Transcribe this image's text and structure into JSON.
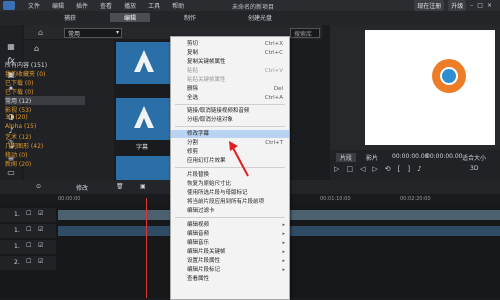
{
  "titlebar": {
    "menu": [
      "文件",
      "编辑",
      "插件",
      "查看",
      "播放",
      "工具",
      "帮助"
    ],
    "app_name": "未命名的新项目",
    "btn_register": "现在注册",
    "btn_upgrade": "升级"
  },
  "tabs": [
    {
      "label": "捕获"
    },
    {
      "label": "编辑"
    },
    {
      "label": "制作"
    },
    {
      "label": "创建光盘"
    }
  ],
  "library": {
    "dropdown": "常用",
    "search_placeholder": "搜索库",
    "categories": [
      {
        "label": "所有内容 (151)",
        "white": true
      },
      {
        "label": "我的收藏夹 (0)"
      },
      {
        "label": "已下载 (0)"
      },
      {
        "label": "已下载 (0)"
      },
      {
        "label": "常用 (12)",
        "white": true
      },
      {
        "label": "影视 (53)"
      },
      {
        "label": "3D (20)"
      },
      {
        "label": "Alpha (15)"
      },
      {
        "label": "艺术 (12)"
      },
      {
        "label": "几何图形 (42)"
      },
      {
        "label": "移动 (0)"
      },
      {
        "label": "新闻 (20)"
      }
    ],
    "thumb_caption": "字幕"
  },
  "context_menu": {
    "items": [
      {
        "label": "剪切",
        "key": "Ctrl+X"
      },
      {
        "label": "复制",
        "key": "Ctrl+C"
      },
      {
        "label": "复制关键帧属性",
        "key": ""
      },
      {
        "label": "粘贴",
        "key": "Ctrl+V"
      },
      {
        "label": "粘贴关键帧属性",
        "key": ""
      },
      {
        "label": "删除",
        "key": "Del"
      },
      {
        "label": "全选",
        "key": "Ctrl+A"
      },
      {
        "sep": true
      },
      {
        "label": "链接/取消链接视频和音频",
        "key": ""
      },
      {
        "label": "分组/取消分组对象",
        "key": ""
      },
      {
        "sep": true
      },
      {
        "label": "修改字幕",
        "key": "",
        "highlight": true
      },
      {
        "label": "分割",
        "key": "Ctrl+T"
      },
      {
        "label": "修剪",
        "key": ""
      },
      {
        "label": "应用幻灯片效果",
        "key": ""
      },
      {
        "sep": true
      },
      {
        "label": "片段替换",
        "key": ""
      },
      {
        "label": "恢复为原始尺寸比",
        "key": ""
      },
      {
        "label": "使用所选片段与母版标记",
        "key": ""
      },
      {
        "label": "将当前片段应用到所有片段前项",
        "key": ""
      },
      {
        "label": "编辑过滤卡",
        "key": ""
      },
      {
        "sep": true
      },
      {
        "label": "编辑视频",
        "key": "",
        "sub": true
      },
      {
        "label": "编辑音频",
        "key": "",
        "sub": true
      },
      {
        "label": "编辑音乐",
        "key": "",
        "sub": true
      },
      {
        "label": "编辑片段关键帧",
        "key": "",
        "sub": true
      },
      {
        "label": "设置片段属性",
        "key": "",
        "sub": true
      },
      {
        "label": "编辑片段标记",
        "key": "",
        "sub": true
      },
      {
        "label": "查看属性",
        "key": ""
      }
    ]
  },
  "preview": {
    "tab_clip": "片段",
    "tab_movie": "影片",
    "timecode_left": "00:00:00.00",
    "timecode_right": "00:00:00.00",
    "fit_label": "适合大小",
    "quality": "3D"
  },
  "timeline": {
    "toolbar_label": "修改",
    "ruler_marks": [
      "00:00:00",
      "00:01:10:00",
      "00:02:20:00"
    ],
    "tracks": [
      {
        "num": "1."
      },
      {
        "num": "1."
      },
      {
        "num": "1."
      },
      {
        "num": "2."
      }
    ]
  }
}
